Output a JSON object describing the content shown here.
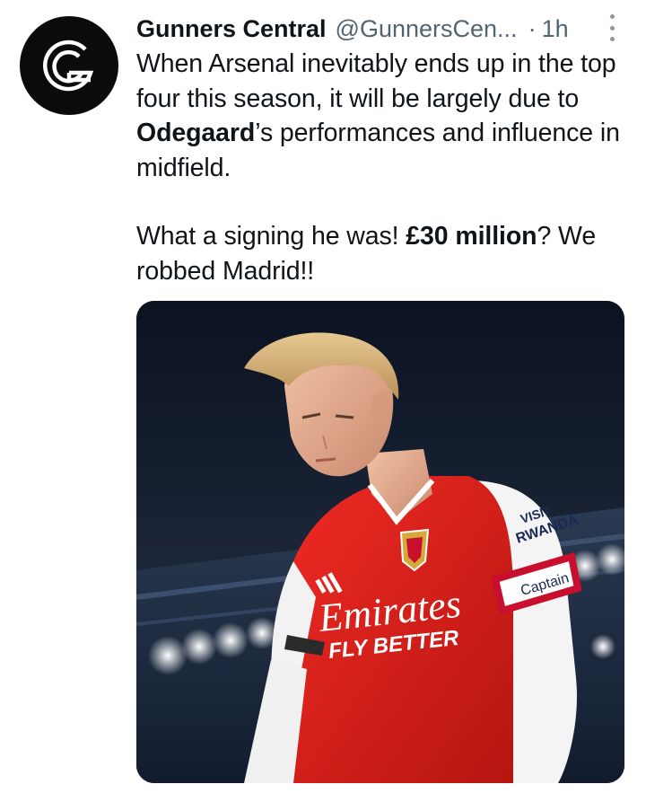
{
  "tweet": {
    "avatar_icon": "letter-g-logo-icon",
    "display_name": "Gunners Central",
    "handle": "@GunnersCen...",
    "separator": "·",
    "timestamp": "1h",
    "more_icon": "more-vertical-icon",
    "body": {
      "p1_part1": "When Arsenal inevitably ends up in the top four this season, it will be largely due to ",
      "p1_bold": "Odegaard",
      "p1_part2": "’s performances and influence in midfield.",
      "p2_part1": "What a signing he was! ",
      "p2_bold": "£30 million",
      "p2_part2": "? We robbed Madrid!!"
    },
    "media": {
      "shirt_sponsor_line1": "Emirates",
      "shirt_sponsor_line2": "FLY BETTER",
      "armband_text": "Captain",
      "sleeve_text_1": "VISIT",
      "sleeve_text_2": "RWANDA"
    },
    "colors": {
      "text_primary": "#0f1419",
      "text_secondary": "#536471",
      "arsenal_red": "#e0201b"
    }
  }
}
